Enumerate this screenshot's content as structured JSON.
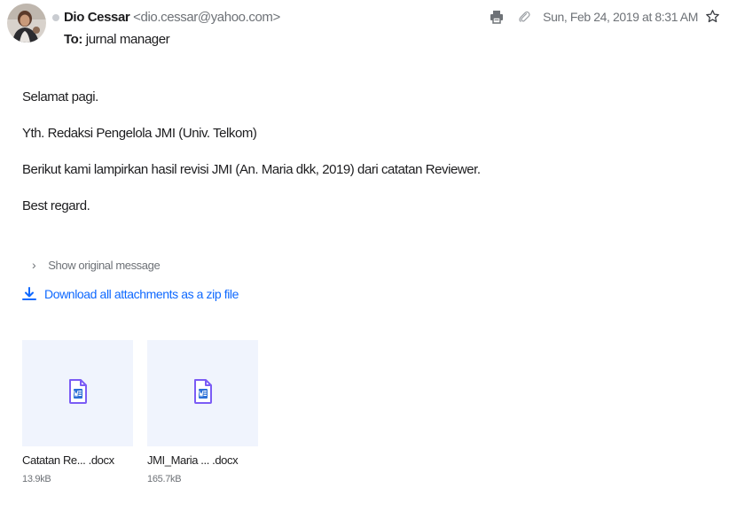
{
  "header": {
    "sender_name": "Dio Cessar",
    "sender_email": "<dio.cessar@yahoo.com>",
    "recipient_label": "To:",
    "recipient_name": "jurnal manager",
    "timestamp": "Sun, Feb 24, 2019 at 8:31 AM",
    "icons": [
      "print-icon",
      "paperclip-icon",
      "star-icon"
    ]
  },
  "body": {
    "paragraphs": [
      "Selamat pagi.",
      "Yth. Redaksi Pengelola JMI (Univ. Telkom)",
      "Berikut kami lampirkan hasil revisi JMI (An. Maria dkk, 2019) dari catatan Reviewer.",
      "Best regard."
    ]
  },
  "actions": {
    "show_original": "Show original message",
    "download_all": "Download all attachments as a zip file"
  },
  "attachments": [
    {
      "name": "Catatan Re... .docx",
      "size": "13.9kB",
      "icon": "word-document-icon"
    },
    {
      "name": "JMI_Maria ... .docx",
      "size": "165.7kB",
      "icon": "word-document-icon"
    }
  ],
  "colors": {
    "link": "#0f69ff",
    "muted": "#6e7277",
    "tile_bg": "#f0f4fd",
    "doc_purple": "#7b5cf5",
    "word_blue": "#2b6fd6"
  }
}
